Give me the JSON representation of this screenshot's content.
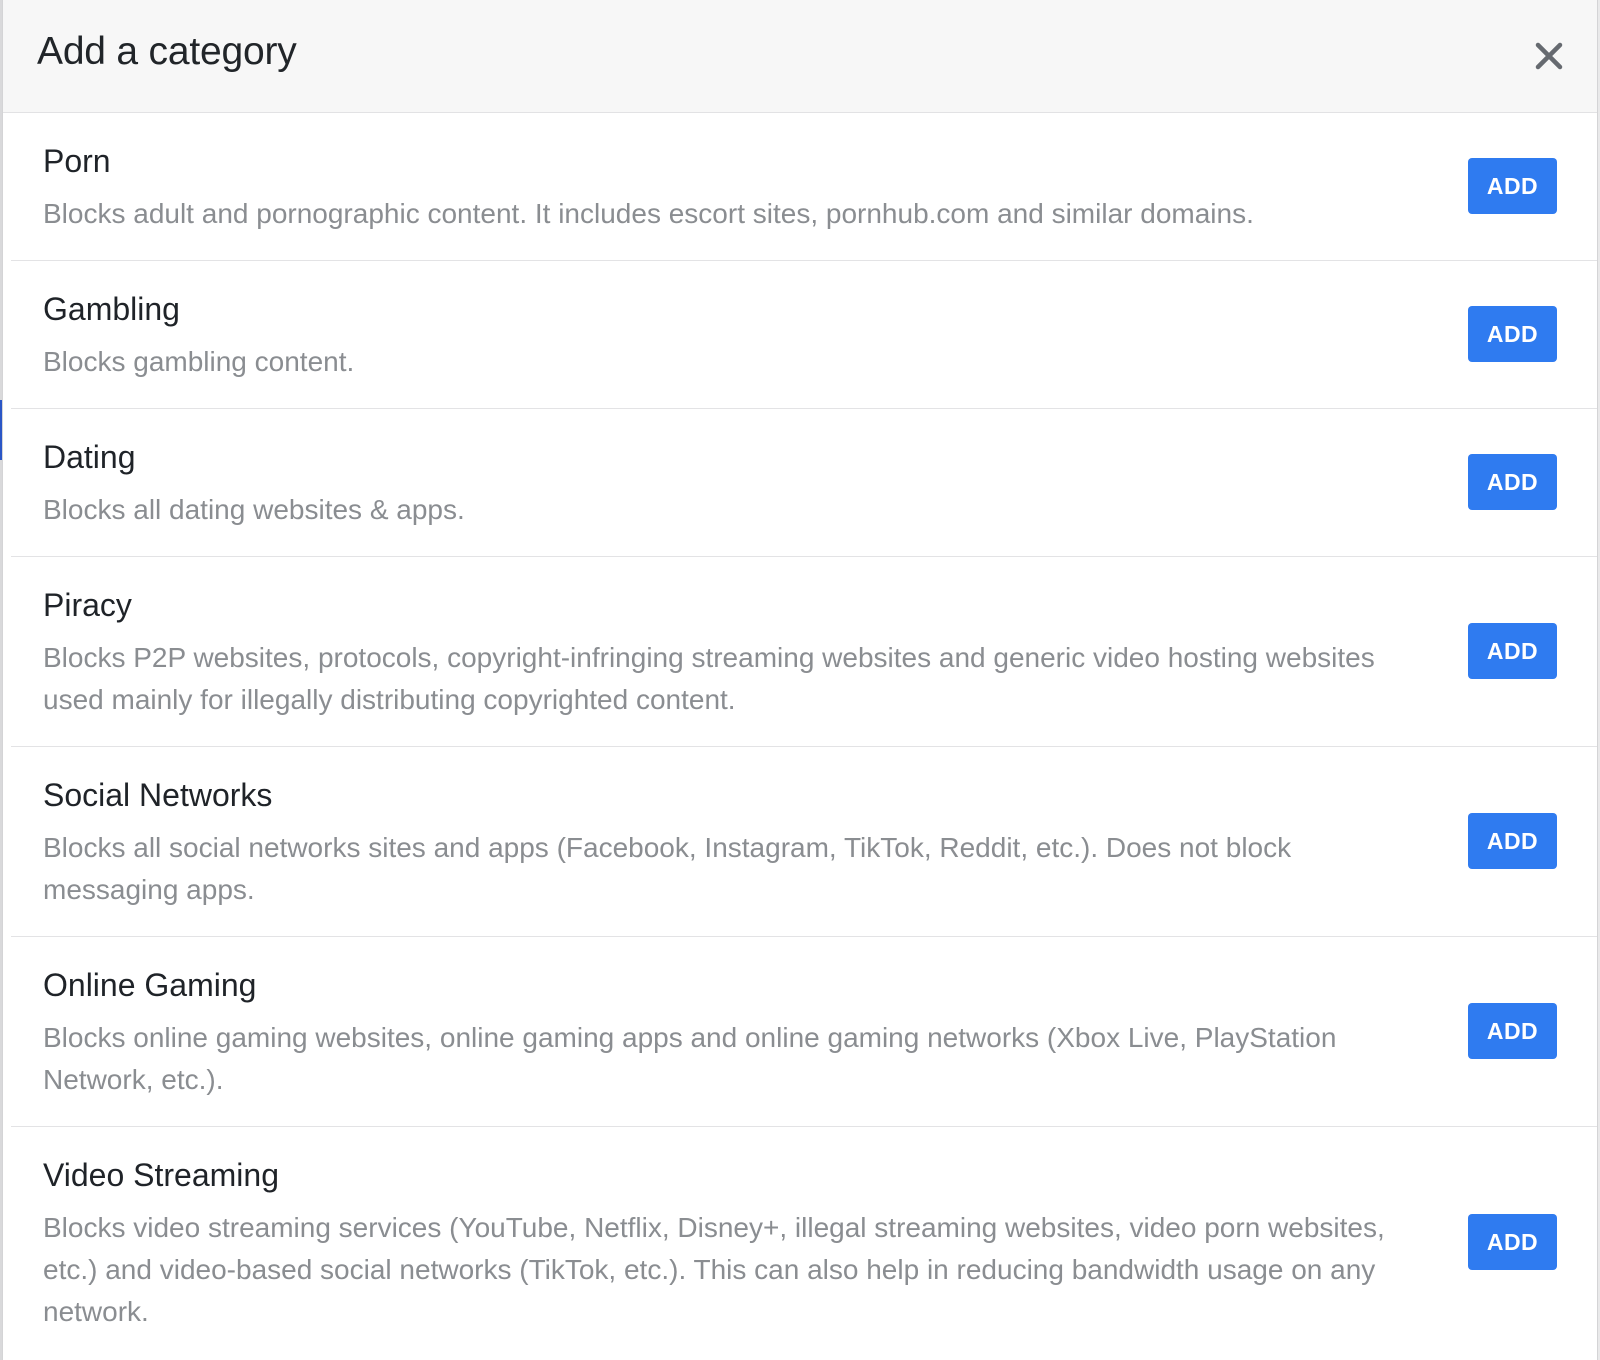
{
  "modal": {
    "title": "Add a category",
    "close_label": "close"
  },
  "categories": [
    {
      "name": "Porn",
      "description": "Blocks adult and pornographic content. It includes escort sites, pornhub.com and similar domains.",
      "button_label": "ADD"
    },
    {
      "name": "Gambling",
      "description": "Blocks gambling content.",
      "button_label": "ADD"
    },
    {
      "name": "Dating",
      "description": "Blocks all dating websites & apps.",
      "button_label": "ADD"
    },
    {
      "name": "Piracy",
      "description": "Blocks P2P websites, protocols, copyright-infringing streaming websites and generic video hosting websites used mainly for illegally distributing copyrighted content.",
      "button_label": "ADD"
    },
    {
      "name": "Social Networks",
      "description": "Blocks all social networks sites and apps (Facebook, Instagram, TikTok, Reddit, etc.). Does not block messaging apps.",
      "button_label": "ADD"
    },
    {
      "name": "Online Gaming",
      "description": "Blocks online gaming websites, online gaming apps and online gaming networks (Xbox Live, PlayStation Network, etc.).",
      "button_label": "ADD"
    },
    {
      "name": "Video Streaming",
      "description": "Blocks video streaming services (YouTube, Netflix, Disney+, illegal streaming websites, video porn websites, etc.) and video-based social networks (TikTok, etc.). This can also help in reducing bandwidth usage on any network.",
      "button_label": "ADD"
    }
  ],
  "colors": {
    "accent": "#2f7bf0",
    "title_text": "#212529",
    "description_text": "#8a8d91",
    "header_background": "#f7f7f7"
  }
}
